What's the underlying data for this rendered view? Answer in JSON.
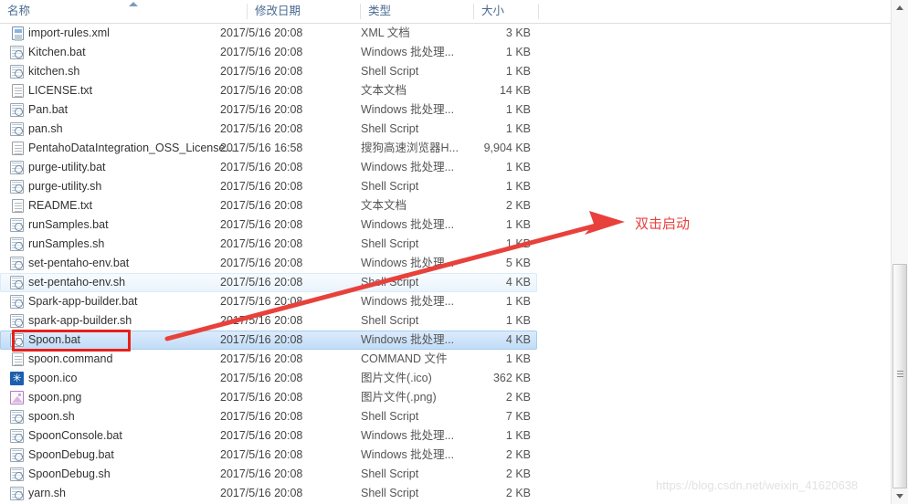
{
  "columns": [
    {
      "key": "name",
      "label": "名称"
    },
    {
      "key": "date",
      "label": "修改日期"
    },
    {
      "key": "type",
      "label": "类型"
    },
    {
      "key": "size",
      "label": "大小"
    }
  ],
  "sort": {
    "column": "名称",
    "direction": "asc"
  },
  "files": [
    {
      "name": "import-rules.xml",
      "date": "2017/5/16 20:08",
      "type": "XML 文档",
      "size": "3 KB",
      "icon": "xml-file-icon",
      "state": "normal"
    },
    {
      "name": "Kitchen.bat",
      "date": "2017/5/16 20:08",
      "type": "Windows 批处理...",
      "size": "1 KB",
      "icon": "script-file-icon",
      "state": "normal"
    },
    {
      "name": "kitchen.sh",
      "date": "2017/5/16 20:08",
      "type": "Shell Script",
      "size": "1 KB",
      "icon": "script-file-icon",
      "state": "normal"
    },
    {
      "name": "LICENSE.txt",
      "date": "2017/5/16 20:08",
      "type": "文本文档",
      "size": "14 KB",
      "icon": "text-file-icon",
      "state": "normal"
    },
    {
      "name": "Pan.bat",
      "date": "2017/5/16 20:08",
      "type": "Windows 批处理...",
      "size": "1 KB",
      "icon": "script-file-icon",
      "state": "normal"
    },
    {
      "name": "pan.sh",
      "date": "2017/5/16 20:08",
      "type": "Shell Script",
      "size": "1 KB",
      "icon": "script-file-icon",
      "state": "normal"
    },
    {
      "name": "PentahoDataIntegration_OSS_License...",
      "date": "2017/5/16 16:58",
      "type": "搜狗高速浏览器H...",
      "size": "9,904 KB",
      "icon": "blank-file-icon",
      "state": "normal"
    },
    {
      "name": "purge-utility.bat",
      "date": "2017/5/16 20:08",
      "type": "Windows 批处理...",
      "size": "1 KB",
      "icon": "script-file-icon",
      "state": "normal"
    },
    {
      "name": "purge-utility.sh",
      "date": "2017/5/16 20:08",
      "type": "Shell Script",
      "size": "1 KB",
      "icon": "script-file-icon",
      "state": "normal"
    },
    {
      "name": "README.txt",
      "date": "2017/5/16 20:08",
      "type": "文本文档",
      "size": "2 KB",
      "icon": "text-file-icon",
      "state": "normal"
    },
    {
      "name": "runSamples.bat",
      "date": "2017/5/16 20:08",
      "type": "Windows 批处理...",
      "size": "1 KB",
      "icon": "script-file-icon",
      "state": "normal"
    },
    {
      "name": "runSamples.sh",
      "date": "2017/5/16 20:08",
      "type": "Shell Script",
      "size": "1 KB",
      "icon": "script-file-icon",
      "state": "normal"
    },
    {
      "name": "set-pentaho-env.bat",
      "date": "2017/5/16 20:08",
      "type": "Windows 批处理...",
      "size": "5 KB",
      "icon": "script-file-icon",
      "state": "normal"
    },
    {
      "name": "set-pentaho-env.sh",
      "date": "2017/5/16 20:08",
      "type": "Shell Script",
      "size": "4 KB",
      "icon": "script-file-icon",
      "state": "hover"
    },
    {
      "name": "Spark-app-builder.bat",
      "date": "2017/5/16 20:08",
      "type": "Windows 批处理...",
      "size": "1 KB",
      "icon": "script-file-icon",
      "state": "normal"
    },
    {
      "name": "spark-app-builder.sh",
      "date": "2017/5/16 20:08",
      "type": "Shell Script",
      "size": "1 KB",
      "icon": "script-file-icon",
      "state": "normal"
    },
    {
      "name": "Spoon.bat",
      "date": "2017/5/16 20:08",
      "type": "Windows 批处理...",
      "size": "4 KB",
      "icon": "script-file-icon",
      "state": "selected"
    },
    {
      "name": "spoon.command",
      "date": "2017/5/16 20:08",
      "type": "COMMAND 文件",
      "size": "1 KB",
      "icon": "blank-file-icon",
      "state": "normal"
    },
    {
      "name": "spoon.ico",
      "date": "2017/5/16 20:08",
      "type": "图片文件(.ico)",
      "size": "362 KB",
      "icon": "ico-image-icon",
      "state": "normal"
    },
    {
      "name": "spoon.png",
      "date": "2017/5/16 20:08",
      "type": "图片文件(.png)",
      "size": "2 KB",
      "icon": "png-image-icon",
      "state": "normal"
    },
    {
      "name": "spoon.sh",
      "date": "2017/5/16 20:08",
      "type": "Shell Script",
      "size": "7 KB",
      "icon": "script-file-icon",
      "state": "normal"
    },
    {
      "name": "SpoonConsole.bat",
      "date": "2017/5/16 20:08",
      "type": "Windows 批处理...",
      "size": "1 KB",
      "icon": "script-file-icon",
      "state": "normal"
    },
    {
      "name": "SpoonDebug.bat",
      "date": "2017/5/16 20:08",
      "type": "Windows 批处理...",
      "size": "2 KB",
      "icon": "script-file-icon",
      "state": "normal"
    },
    {
      "name": "SpoonDebug.sh",
      "date": "2017/5/16 20:08",
      "type": "Shell Script",
      "size": "2 KB",
      "icon": "script-file-icon",
      "state": "normal"
    },
    {
      "name": "yarn.sh",
      "date": "2017/5/16 20:08",
      "type": "Shell Script",
      "size": "2 KB",
      "icon": "script-file-icon",
      "state": "normal"
    }
  ],
  "annotation": {
    "text": "双击启动",
    "color": "#e8413c",
    "highlight_box_color": "#e8201a",
    "highlight_target": "Spoon.bat"
  },
  "watermark": {
    "text": "https://blog.csdn.net/weixin_41620638"
  },
  "scrollbar": {
    "up_arrow": "▲",
    "down_arrow": "▼"
  }
}
